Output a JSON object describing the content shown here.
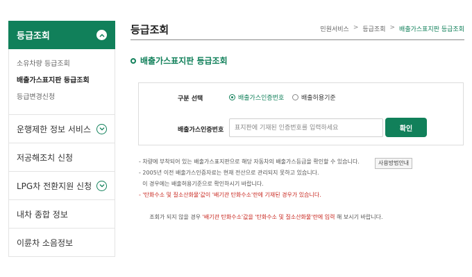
{
  "sidebar": {
    "header_label": "등급조회",
    "submenu": [
      {
        "label": "소유차량 등급조회",
        "active": false
      },
      {
        "label": "배출가스표지판 등급조회",
        "active": true
      },
      {
        "label": "등급변경신청",
        "active": false
      }
    ],
    "items": [
      {
        "label": "운행제한 정보 서비스",
        "expandable": true
      },
      {
        "label": "저공해조치 신청",
        "expandable": false
      },
      {
        "label": "LPG차 전환지원 신청",
        "expandable": true
      },
      {
        "label": "내차 종합 정보",
        "expandable": false
      },
      {
        "label": "이륜차 소음정보",
        "expandable": false
      }
    ]
  },
  "header": {
    "title": "등급조회",
    "breadcrumb": [
      "민원서비스",
      "등급조회",
      "배출가스표지판 등급조회"
    ],
    "separator": ">"
  },
  "section": {
    "title": "배출가스표지판 등급조회"
  },
  "form": {
    "type_label": "구분 선택",
    "options": [
      {
        "label": "배출가스인증번호",
        "checked": true
      },
      {
        "label": "배출허용기준",
        "checked": false
      }
    ],
    "cert_label": "배출가스인증번호",
    "cert_placeholder": "표지판에 기재된 인증번호를 입력하세요",
    "cert_value": "",
    "confirm_label": "확인"
  },
  "notes": {
    "line1": "- 차량에 부착되어 있는 배출가스표지판으로 해당 자동차의 배출가스등급을 확인할 수 있습니다.",
    "guide_button": "사용방법안내",
    "line2": "- 2005년 이전 배출가스인증자료는 현재 전산으로 관리되지 못하고 있습니다.",
    "line3": "  이 경우에는 배출허용기준으로 확인하시기 바랍니다.",
    "line4": "- '탄화수소 및 질소산화물'값이 '배기관 탄화수소'란에 기재된 경우가 있습니다.",
    "line5_pre": "  조회가 되지 않을 경우 ",
    "line5_red": "'배기관 탄화수소'값을 '탄화수소 및 질소산화물'란에 입력",
    "line5_post": " 해 보시기 바랍니다."
  },
  "colors": {
    "accent": "#11805a",
    "warning": "#c8271f"
  }
}
